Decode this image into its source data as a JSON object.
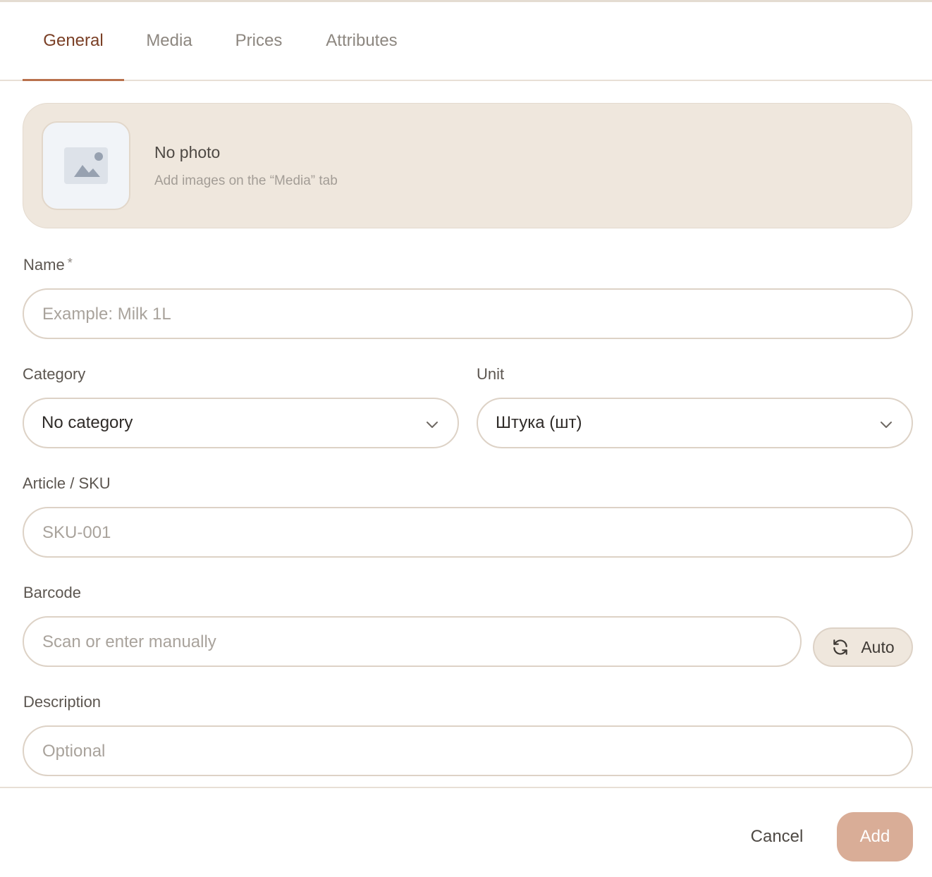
{
  "tabs": [
    {
      "label": "General",
      "active": true
    },
    {
      "label": "Media",
      "active": false
    },
    {
      "label": "Prices",
      "active": false
    },
    {
      "label": "Attributes",
      "active": false
    }
  ],
  "photo": {
    "title": "No photo",
    "subtitle": "Add images on the “Media” tab",
    "icon": "image-placeholder-icon"
  },
  "name": {
    "label": "Name",
    "required_mark": "*",
    "placeholder": "Example: Milk 1L",
    "value": ""
  },
  "category": {
    "label": "Category",
    "value": "No category",
    "icon": "chevron-down-icon"
  },
  "unit": {
    "label": "Unit",
    "value": "Штука (шт)",
    "icon": "chevron-down-icon"
  },
  "sku": {
    "label": "Article / SKU",
    "placeholder": "SKU-001",
    "value": ""
  },
  "barcode": {
    "label": "Barcode",
    "placeholder": "Scan or enter manually",
    "value": "",
    "auto_label": "Auto",
    "auto_icon": "refresh-icon"
  },
  "description": {
    "label": "Description",
    "placeholder": "Optional",
    "value": ""
  },
  "footer": {
    "cancel_label": "Cancel",
    "add_label": "Add"
  },
  "colors": {
    "accent": "#7a3f25",
    "tab_underline": "#b9714c",
    "panel_bg": "#efe7dd",
    "add_button": "#d9ad97"
  }
}
